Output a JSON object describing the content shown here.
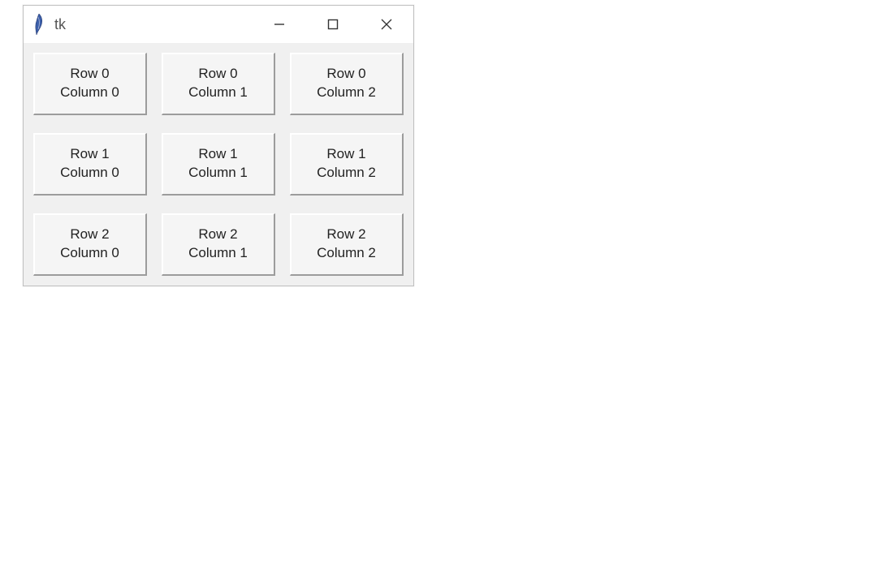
{
  "window": {
    "title": "tk",
    "icons": {
      "app": "feather-icon",
      "minimize": "minimize-icon",
      "maximize": "maximize-icon",
      "close": "close-icon"
    }
  },
  "grid": {
    "rows": 3,
    "cols": 3,
    "buttons": [
      [
        "Row 0\nColumn 0",
        "Row 0\nColumn 1",
        "Row 0\nColumn 2"
      ],
      [
        "Row 1\nColumn 0",
        "Row 1\nColumn 1",
        "Row 1\nColumn 2"
      ],
      [
        "Row 2\nColumn 0",
        "Row 2\nColumn 1",
        "Row 2\nColumn 2"
      ]
    ]
  }
}
